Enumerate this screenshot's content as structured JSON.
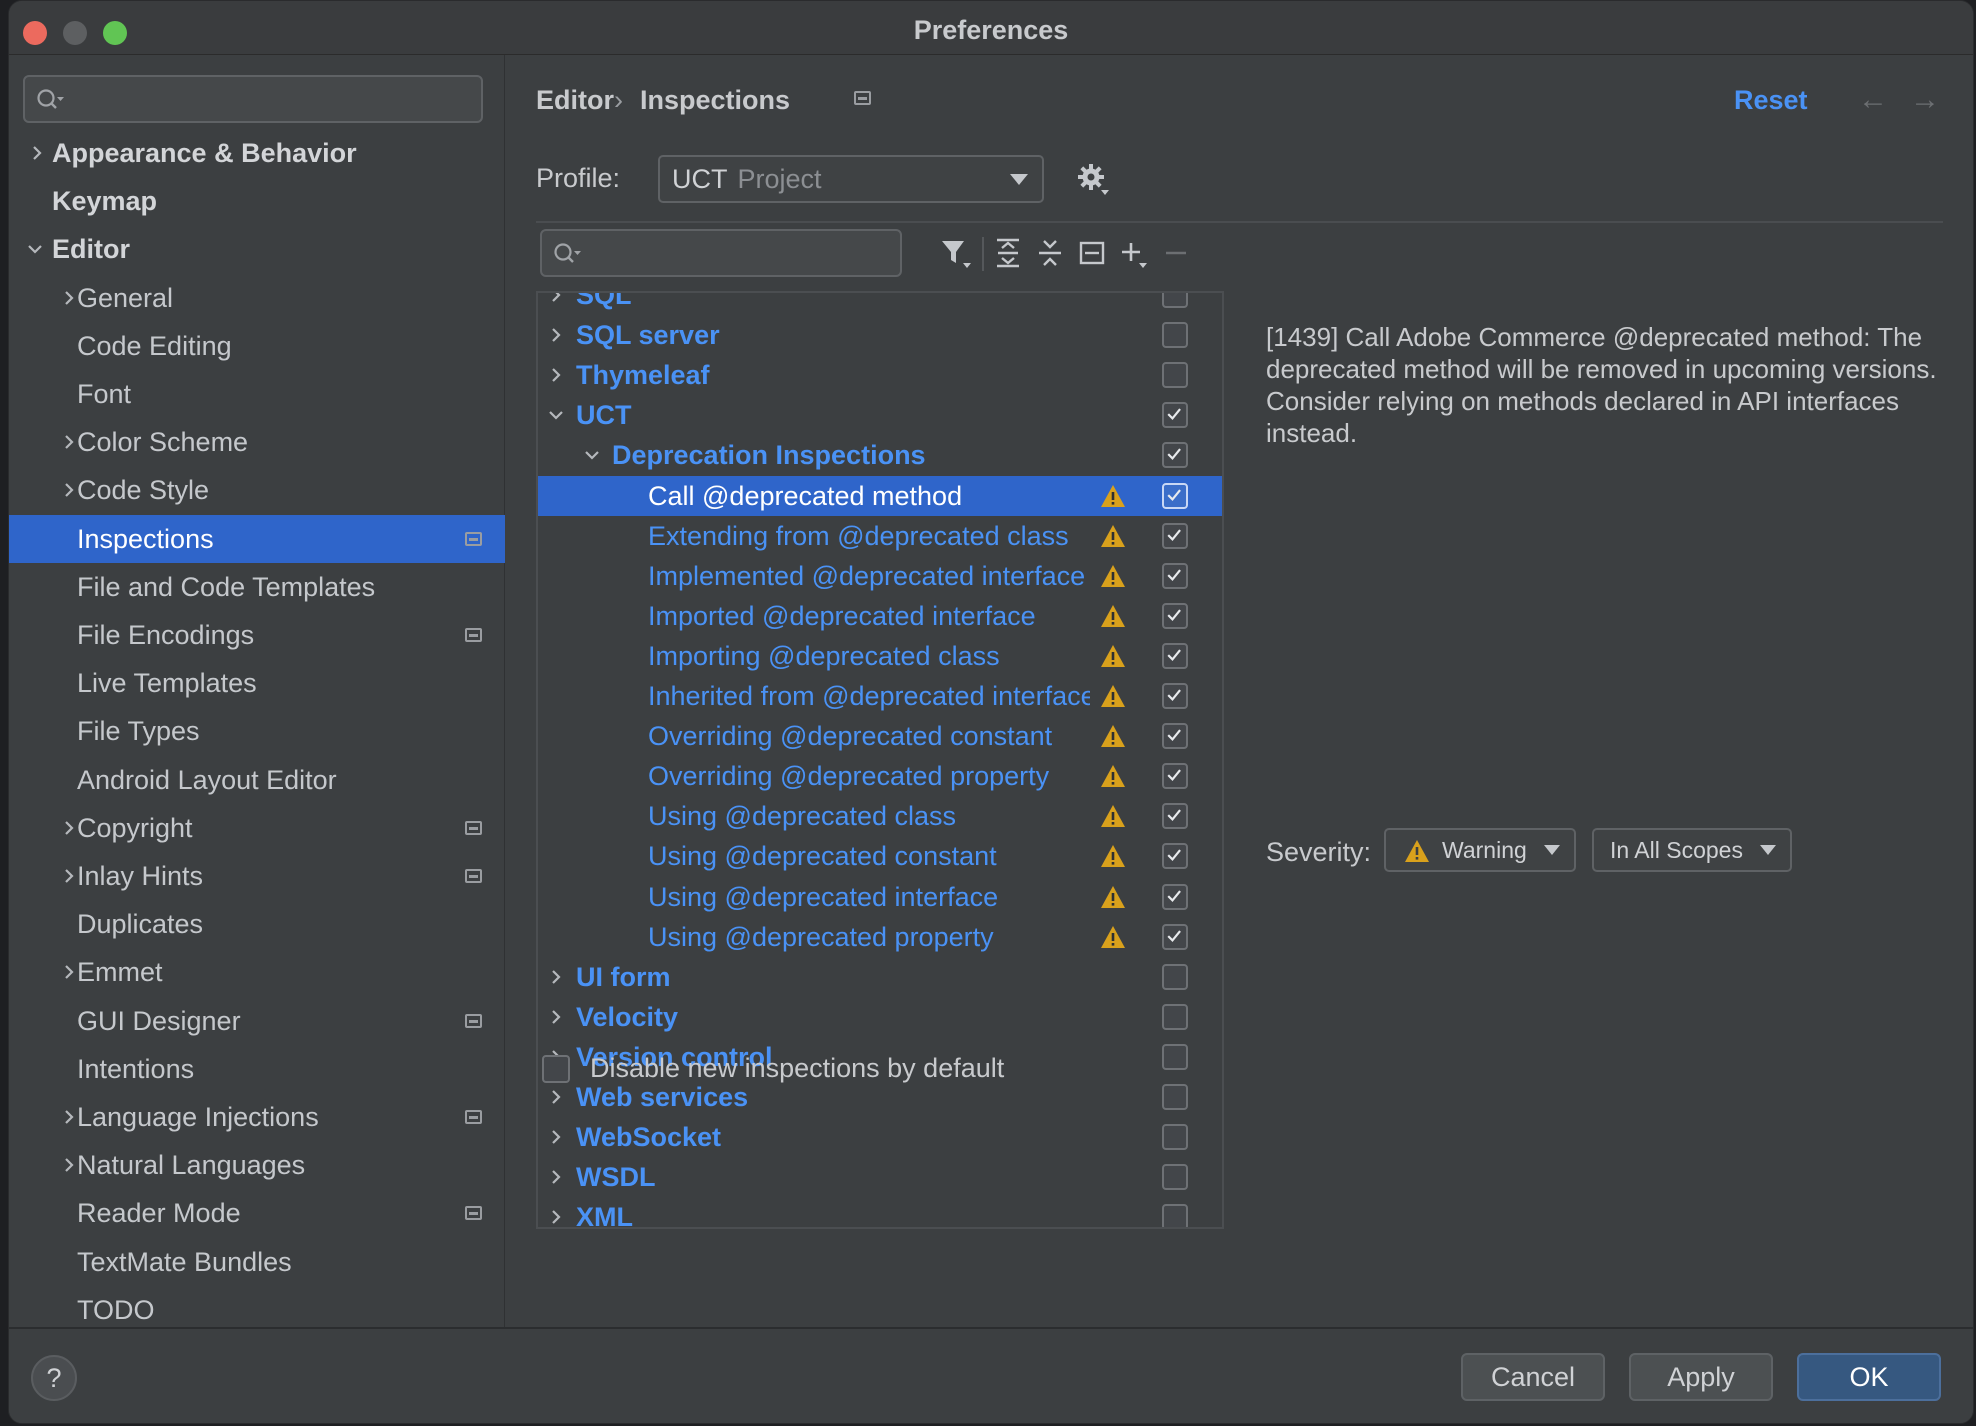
{
  "window": {
    "title": "Preferences"
  },
  "sidebar": {
    "search_placeholder": "",
    "items": [
      {
        "label": "Appearance & Behavior",
        "level": 0,
        "chevron": "right",
        "bold": true,
        "badge": false,
        "selected": false
      },
      {
        "label": "Keymap",
        "level": 0,
        "chevron": "none",
        "bold": true,
        "badge": false,
        "selected": false
      },
      {
        "label": "Editor",
        "level": 0,
        "chevron": "down",
        "bold": true,
        "badge": false,
        "selected": false
      },
      {
        "label": "General",
        "level": 1,
        "chevron": "right",
        "bold": false,
        "badge": false,
        "selected": false
      },
      {
        "label": "Code Editing",
        "level": 1,
        "chevron": "none",
        "bold": false,
        "badge": false,
        "selected": false
      },
      {
        "label": "Font",
        "level": 1,
        "chevron": "none",
        "bold": false,
        "badge": false,
        "selected": false
      },
      {
        "label": "Color Scheme",
        "level": 1,
        "chevron": "right",
        "bold": false,
        "badge": false,
        "selected": false
      },
      {
        "label": "Code Style",
        "level": 1,
        "chevron": "right",
        "bold": false,
        "badge": false,
        "selected": false
      },
      {
        "label": "Inspections",
        "level": 1,
        "chevron": "none",
        "bold": false,
        "badge": true,
        "selected": true
      },
      {
        "label": "File and Code Templates",
        "level": 1,
        "chevron": "none",
        "bold": false,
        "badge": false,
        "selected": false
      },
      {
        "label": "File Encodings",
        "level": 1,
        "chevron": "none",
        "bold": false,
        "badge": true,
        "selected": false
      },
      {
        "label": "Live Templates",
        "level": 1,
        "chevron": "none",
        "bold": false,
        "badge": false,
        "selected": false
      },
      {
        "label": "File Types",
        "level": 1,
        "chevron": "none",
        "bold": false,
        "badge": false,
        "selected": false
      },
      {
        "label": "Android Layout Editor",
        "level": 1,
        "chevron": "none",
        "bold": false,
        "badge": false,
        "selected": false
      },
      {
        "label": "Copyright",
        "level": 1,
        "chevron": "right",
        "bold": false,
        "badge": true,
        "selected": false
      },
      {
        "label": "Inlay Hints",
        "level": 1,
        "chevron": "right",
        "bold": false,
        "badge": true,
        "selected": false
      },
      {
        "label": "Duplicates",
        "level": 1,
        "chevron": "none",
        "bold": false,
        "badge": false,
        "selected": false
      },
      {
        "label": "Emmet",
        "level": 1,
        "chevron": "right",
        "bold": false,
        "badge": false,
        "selected": false
      },
      {
        "label": "GUI Designer",
        "level": 1,
        "chevron": "none",
        "bold": false,
        "badge": true,
        "selected": false
      },
      {
        "label": "Intentions",
        "level": 1,
        "chevron": "none",
        "bold": false,
        "badge": false,
        "selected": false
      },
      {
        "label": "Language Injections",
        "level": 1,
        "chevron": "right",
        "bold": false,
        "badge": true,
        "selected": false
      },
      {
        "label": "Natural Languages",
        "level": 1,
        "chevron": "right",
        "bold": false,
        "badge": false,
        "selected": false
      },
      {
        "label": "Reader Mode",
        "level": 1,
        "chevron": "none",
        "bold": false,
        "badge": true,
        "selected": false
      },
      {
        "label": "TextMate Bundles",
        "level": 1,
        "chevron": "none",
        "bold": false,
        "badge": false,
        "selected": false
      },
      {
        "label": "TODO",
        "level": 1,
        "chevron": "none",
        "bold": false,
        "badge": false,
        "selected": false
      }
    ]
  },
  "header": {
    "breadcrumb": [
      "Editor",
      "Inspections"
    ],
    "breadcrumb_separator": "›",
    "reset_label": "Reset",
    "back_arrow": "←",
    "forward_arrow": "→"
  },
  "profile": {
    "label": "Profile:",
    "value": "UCT",
    "scope": "Project"
  },
  "inspections": {
    "search_placeholder": "",
    "toolbar_icons": [
      "filter-icon",
      "expand-all-icon",
      "collapse-all-icon",
      "reset-to-empty-icon",
      "add-icon",
      "remove-icon"
    ],
    "rows": [
      {
        "label": "SQL",
        "level": 0,
        "chevron": "right",
        "bold": true,
        "warning": false,
        "checked": false,
        "selected": false
      },
      {
        "label": "SQL server",
        "level": 0,
        "chevron": "right",
        "bold": true,
        "warning": false,
        "checked": false,
        "selected": false
      },
      {
        "label": "Thymeleaf",
        "level": 0,
        "chevron": "right",
        "bold": true,
        "warning": false,
        "checked": false,
        "selected": false
      },
      {
        "label": "UCT",
        "level": 0,
        "chevron": "down",
        "bold": true,
        "warning": false,
        "checked": true,
        "selected": false
      },
      {
        "label": "Deprecation Inspections",
        "level": 1,
        "chevron": "down",
        "bold": true,
        "warning": false,
        "checked": true,
        "selected": false
      },
      {
        "label": "Call @deprecated method",
        "level": 2,
        "chevron": "none",
        "bold": false,
        "warning": true,
        "checked": true,
        "selected": true
      },
      {
        "label": "Extending from @deprecated class",
        "level": 2,
        "chevron": "none",
        "bold": false,
        "warning": true,
        "checked": true,
        "selected": false
      },
      {
        "label": "Implemented @deprecated interface",
        "level": 2,
        "chevron": "none",
        "bold": false,
        "warning": true,
        "checked": true,
        "selected": false
      },
      {
        "label": "Imported @deprecated interface",
        "level": 2,
        "chevron": "none",
        "bold": false,
        "warning": true,
        "checked": true,
        "selected": false
      },
      {
        "label": "Importing @deprecated class",
        "level": 2,
        "chevron": "none",
        "bold": false,
        "warning": true,
        "checked": true,
        "selected": false
      },
      {
        "label": "Inherited from @deprecated interface",
        "level": 2,
        "chevron": "none",
        "bold": false,
        "warning": true,
        "checked": true,
        "selected": false
      },
      {
        "label": "Overriding @deprecated constant",
        "level": 2,
        "chevron": "none",
        "bold": false,
        "warning": true,
        "checked": true,
        "selected": false
      },
      {
        "label": "Overriding @deprecated property",
        "level": 2,
        "chevron": "none",
        "bold": false,
        "warning": true,
        "checked": true,
        "selected": false
      },
      {
        "label": "Using @deprecated class",
        "level": 2,
        "chevron": "none",
        "bold": false,
        "warning": true,
        "checked": true,
        "selected": false
      },
      {
        "label": "Using @deprecated constant",
        "level": 2,
        "chevron": "none",
        "bold": false,
        "warning": true,
        "checked": true,
        "selected": false
      },
      {
        "label": "Using @deprecated interface",
        "level": 2,
        "chevron": "none",
        "bold": false,
        "warning": true,
        "checked": true,
        "selected": false
      },
      {
        "label": "Using @deprecated property",
        "level": 2,
        "chevron": "none",
        "bold": false,
        "warning": true,
        "checked": true,
        "selected": false
      },
      {
        "label": "UI form",
        "level": 0,
        "chevron": "right",
        "bold": true,
        "warning": false,
        "checked": false,
        "selected": false
      },
      {
        "label": "Velocity",
        "level": 0,
        "chevron": "right",
        "bold": true,
        "warning": false,
        "checked": false,
        "selected": false
      },
      {
        "label": "Version control",
        "level": 0,
        "chevron": "right",
        "bold": true,
        "warning": false,
        "checked": false,
        "selected": false
      },
      {
        "label": "Web services",
        "level": 0,
        "chevron": "right",
        "bold": true,
        "warning": false,
        "checked": false,
        "selected": false
      },
      {
        "label": "WebSocket",
        "level": 0,
        "chevron": "right",
        "bold": true,
        "warning": false,
        "checked": false,
        "selected": false
      },
      {
        "label": "WSDL",
        "level": 0,
        "chevron": "right",
        "bold": true,
        "warning": false,
        "checked": false,
        "selected": false
      },
      {
        "label": "XML",
        "level": 0,
        "chevron": "right",
        "bold": true,
        "warning": false,
        "checked": false,
        "selected": false
      }
    ],
    "disable_new_label": "Disable new inspections by default",
    "disable_new_checked": false
  },
  "details": {
    "description": "[1439] Call Adobe Commerce @deprecated method: The deprecated method will be removed in upcoming versions. Consider relying on methods declared in API interfaces instead.",
    "severity_label": "Severity:",
    "severity_value": "Warning",
    "scope_value": "In All Scopes"
  },
  "footer": {
    "help_label": "?",
    "cancel_label": "Cancel",
    "apply_label": "Apply",
    "ok_label": "OK"
  },
  "colors": {
    "accent": "#4a92f5",
    "selection": "#2f65ca",
    "warning": "#d9a11c",
    "background": "#3c3f41"
  }
}
